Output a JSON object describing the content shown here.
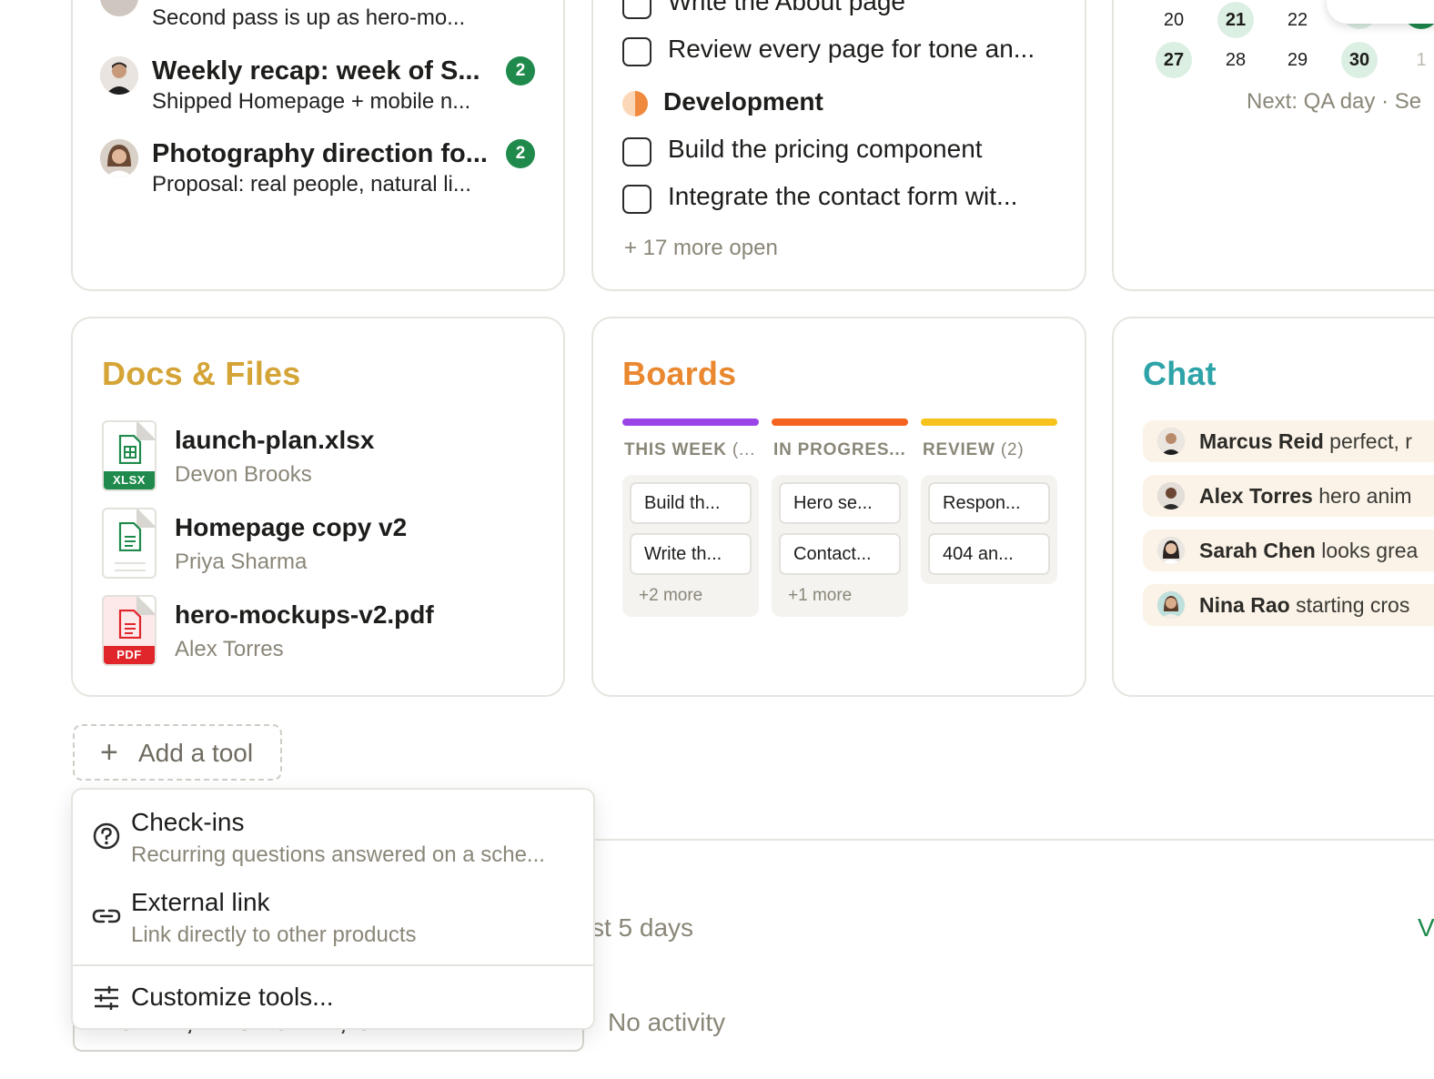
{
  "messages": [
    {
      "preview": "Second pass is up as hero-mo..."
    },
    {
      "title": "Weekly recap: week of S...",
      "preview": "Shipped Homepage + mobile n...",
      "badge": "2"
    },
    {
      "title": "Photography direction fo...",
      "preview": "Proposal: real people, natural li...",
      "badge": "2"
    }
  ],
  "todos": {
    "first_partial": "Write the About page",
    "first_group_items": [
      "Review every page for tone an..."
    ],
    "group_heading": "Development",
    "group_items": [
      "Build the pricing component",
      "Integrate the contact form wit..."
    ],
    "more_open": "+ 17 more open"
  },
  "calendar": {
    "row1": [
      "20",
      "21",
      "22"
    ],
    "row2": [
      "27",
      "28",
      "29",
      "30",
      "1"
    ],
    "highlighted": [
      "21",
      "27",
      "30"
    ],
    "next_text": "Next: QA day · Se"
  },
  "docs": {
    "title": "Docs & Files",
    "title_color": "#d4a437",
    "files": [
      {
        "name": "launch-plan.xlsx",
        "author": "Devon Brooks",
        "tag": "XLSX",
        "color": "#1f8a4c"
      },
      {
        "name": "Homepage copy v2",
        "author": "Priya Sharma",
        "tag": "",
        "color": "#1f8a4c"
      },
      {
        "name": "hero-mockups-v2.pdf",
        "author": "Alex Torres",
        "tag": "PDF",
        "color": "#e0262b"
      }
    ]
  },
  "boards": {
    "title": "Boards",
    "title_color": "#e9882f",
    "columns": [
      {
        "name": "THIS WEEK",
        "count": "(...",
        "color": "#9b45e8",
        "cards": [
          "Build th...",
          "Write th..."
        ],
        "more": "+2 more"
      },
      {
        "name": "IN PROGRES...",
        "count": "",
        "color": "#f5641e",
        "cards": [
          "Hero se...",
          "Contact..."
        ],
        "more": "+1 more"
      },
      {
        "name": "REVIEW",
        "count": "(2)",
        "color": "#f6c21b",
        "cards": [
          "Respon...",
          "404 an..."
        ],
        "more": ""
      }
    ]
  },
  "chat": {
    "title": "Chat",
    "title_color": "#2ea3a8",
    "lines": [
      {
        "name": "Marcus Reid",
        "text": " perfect, r"
      },
      {
        "name": "Alex Torres",
        "text": " hero anim"
      },
      {
        "name": "Sarah Chen",
        "text": " looks grea"
      },
      {
        "name": "Nina Rao",
        "text": " starting cros"
      }
    ]
  },
  "add_tool": {
    "label": "Add a tool"
  },
  "menu": {
    "items": [
      {
        "label": "Check-ins",
        "description": "Recurring questions answered on a sche..."
      },
      {
        "label": "External link",
        "description": "Link directly to other products"
      }
    ],
    "customize": "Customize tools..."
  },
  "activity": {
    "range_partial": "st 5 days",
    "no_activity": "No activity",
    "today_partial": "TODAY, THURSDAY, SEPTEMBER 24",
    "right_partial": "V"
  }
}
